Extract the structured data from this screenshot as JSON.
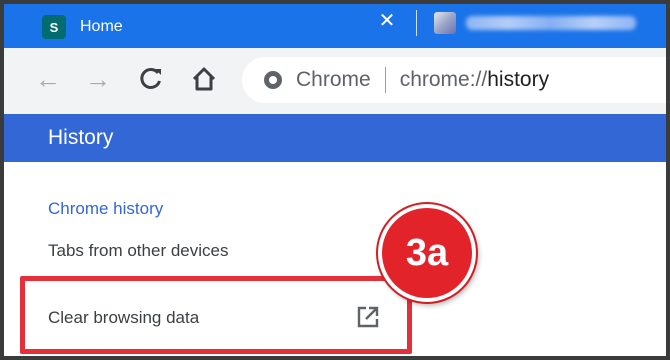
{
  "browser": {
    "active_tab": {
      "title": "Home",
      "favicon_letter": "S",
      "close_glyph": "✕"
    },
    "toolbar": {
      "back_glyph": "←",
      "forward_glyph": "→",
      "reload_glyph": "C",
      "home_icon": "home-icon",
      "omnibox": {
        "site_label": "Chrome",
        "url_scheme": "chrome://",
        "url_path": "history"
      }
    }
  },
  "history_page": {
    "header_title": "History",
    "menu": {
      "chrome_history": "Chrome history",
      "tabs_other_devices": "Tabs from other devices",
      "clear_browsing_data": "Clear browsing data"
    }
  },
  "annotation": {
    "badge": "3a",
    "color": "#e3303a"
  },
  "colors": {
    "tab_strip": "#1a73e8",
    "header": "#3367d6",
    "active_link": "#3367d6"
  }
}
